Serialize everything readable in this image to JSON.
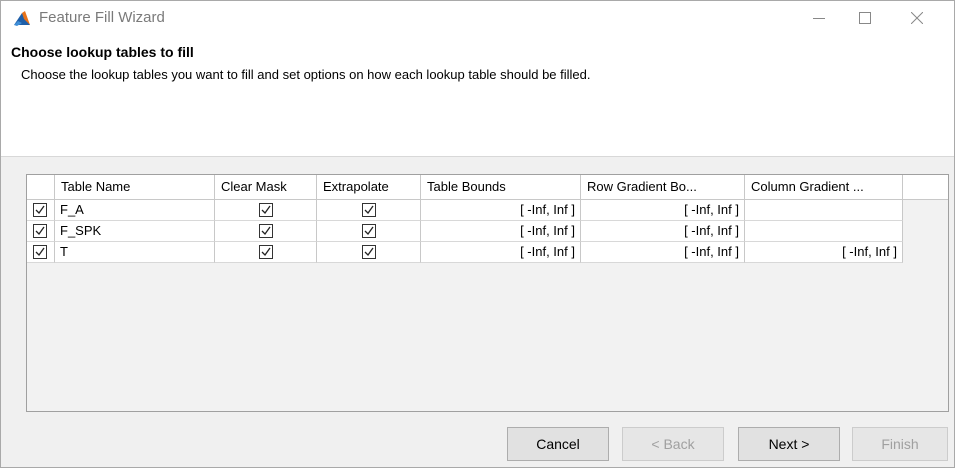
{
  "window": {
    "title": "Feature Fill Wizard"
  },
  "header": {
    "heading": "Choose lookup tables to fill",
    "description": "Choose the lookup tables you want to fill and set options on how each lookup table should be filled."
  },
  "table": {
    "columns": [
      "",
      "Table Name",
      "Clear Mask",
      "Extrapolate",
      "Table Bounds",
      "Row Gradient Bo...",
      "Column Gradient ..."
    ],
    "rows": [
      {
        "selected": true,
        "name": "F_A",
        "clear_mask": true,
        "extrapolate": true,
        "table_bounds": "[ -Inf, Inf ]",
        "row_gradient": "[ -Inf, Inf ]",
        "column_gradient": ""
      },
      {
        "selected": true,
        "name": "F_SPK",
        "clear_mask": true,
        "extrapolate": true,
        "table_bounds": "[ -Inf, Inf ]",
        "row_gradient": "[ -Inf, Inf ]",
        "column_gradient": ""
      },
      {
        "selected": true,
        "name": "T",
        "clear_mask": true,
        "extrapolate": true,
        "table_bounds": "[ -Inf, Inf ]",
        "row_gradient": "[ -Inf, Inf ]",
        "column_gradient": "[ -Inf, Inf ]"
      }
    ]
  },
  "buttons": {
    "cancel": "Cancel",
    "back": "< Back",
    "next": "Next >",
    "finish": "Finish"
  },
  "colors": {
    "app_icon_blue": "#1f5fa8",
    "app_icon_orange": "#e8731a",
    "dialog_background": "#f0f0f0"
  }
}
